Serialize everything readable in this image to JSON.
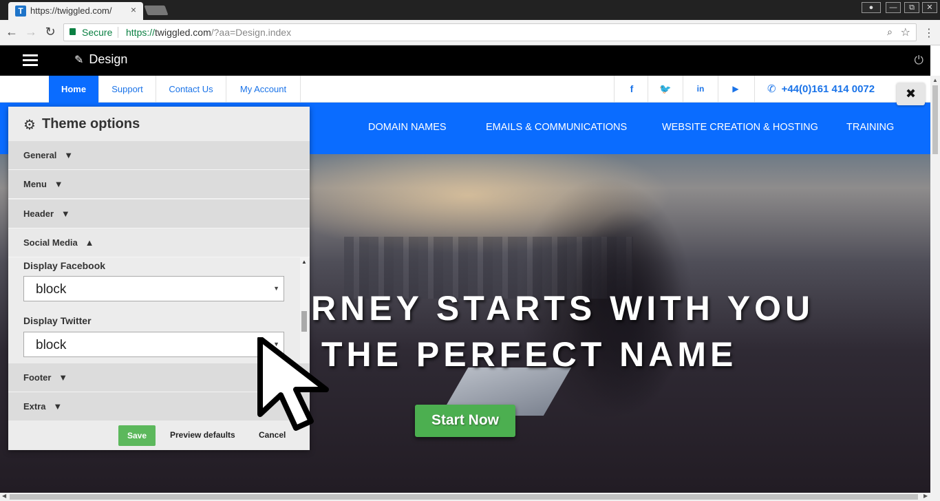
{
  "browser": {
    "tab_title": "https://twiggled.com/",
    "tab_favicon": "T",
    "tab_close": "×",
    "secure_label": "Secure",
    "url_scheme": "https://",
    "url_host": "twiggled.com",
    "url_path": "/?aa=Design.index",
    "window_buttons": [
      "—",
      "⧉",
      "✕"
    ]
  },
  "admin_bar": {
    "title": "Design"
  },
  "topbar": {
    "links": [
      {
        "label": "Home"
      },
      {
        "label": "Support"
      },
      {
        "label": "Contact Us"
      },
      {
        "label": "My Account"
      }
    ],
    "social": [
      "f",
      "t",
      "in",
      "yt"
    ],
    "phone": "+44(0)161 414 0072"
  },
  "main_nav": {
    "items": [
      {
        "label": "DOMAIN NAMES"
      },
      {
        "label": "EMAILS & COMMUNICATIONS"
      },
      {
        "label": "WEBSITE CREATION & HOSTING"
      },
      {
        "label": "TRAINING"
      }
    ]
  },
  "hero": {
    "line1": "RNEY STARTS WITH YOU",
    "line2": "THE PERFECT NAME",
    "cta": "Start Now"
  },
  "close_button": "✖",
  "theme_panel": {
    "title": "Theme options",
    "sections": [
      {
        "label": "General",
        "arrow": "▼"
      },
      {
        "label": "Menu",
        "arrow": "▼"
      },
      {
        "label": "Header",
        "arrow": "▼"
      },
      {
        "label": "Social Media",
        "arrow": "▲"
      },
      {
        "label": "Footer",
        "arrow": "▼"
      },
      {
        "label": "Extra",
        "arrow": "▼"
      }
    ],
    "fields": [
      {
        "label": "Display Facebook",
        "value": "block"
      },
      {
        "label": "Display Twitter",
        "value": "block"
      }
    ],
    "footer": {
      "save": "Save",
      "preview_defaults": "Preview defaults",
      "cancel": "Cancel"
    }
  },
  "colors": {
    "brand_blue": "#0a6cff",
    "admin_bar": "#000000",
    "save_green": "#5cb85c",
    "cta_green": "#4caf50"
  }
}
